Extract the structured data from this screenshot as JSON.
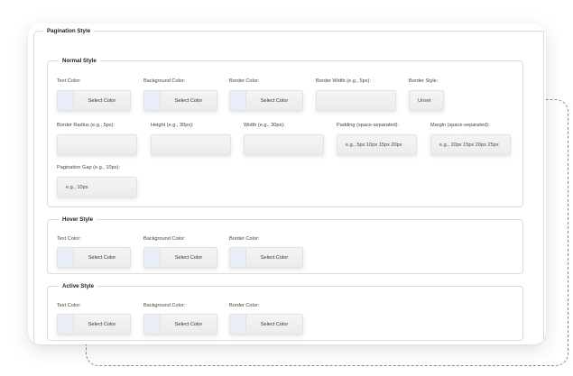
{
  "pagination": {
    "title": "Pagination Style",
    "normal": {
      "title": "Normal Style",
      "text_color_label": "Text Color:",
      "bg_color_label": "Background Color:",
      "border_color_label": "Border Color:",
      "border_width_label": "Border Width (e.g., 5px):",
      "border_style_label": "Border Style:",
      "border_style_value": "Unset",
      "border_radius_label": "Border Radius (e.g., 5px):",
      "height_label": "Height (e.g., 30px):",
      "width_label": "Width (e.g., 30px):",
      "padding_label": "Padding (space-separated):",
      "padding_placeholder": "e.g., 5px 10px 15px 20px",
      "margin_label": "Margin (space-separated):",
      "margin_placeholder": "e.g., 10px 15px 20px 25px",
      "gap_label": "Pagination Gap (e.g., 10px):",
      "gap_placeholder": "e.g., 10px"
    },
    "hover": {
      "title": "Hover Style",
      "text_color_label": "Text Color:",
      "bg_color_label": "Background Color:",
      "border_color_label": "Border Color:"
    },
    "active": {
      "title": "Active Style",
      "text_color_label": "Text Color:",
      "bg_color_label": "Background Color:",
      "border_color_label": "Border Color:"
    },
    "select_color_label": "Select Color"
  }
}
